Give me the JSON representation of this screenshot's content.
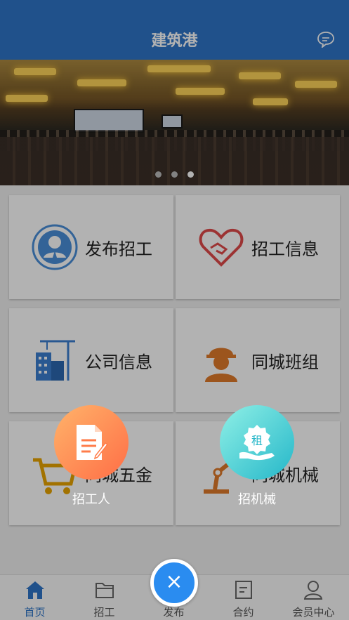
{
  "header": {
    "title": "建筑港",
    "chat_icon": "chat-bubble-icon"
  },
  "banner": {
    "slides": 3,
    "active_slide": 3
  },
  "grid": [
    {
      "label": "发布招工",
      "icon": "worker-avatar-icon",
      "color": "#4a8fd8"
    },
    {
      "label": "招工信息",
      "icon": "heart-handshake-icon",
      "color": "#e04a4a"
    },
    {
      "label": "公司信息",
      "icon": "building-crane-icon",
      "color": "#3b7fd0"
    },
    {
      "label": "同城班组",
      "icon": "helmet-worker-icon",
      "color": "#e07a2a"
    },
    {
      "label": "同城五金",
      "icon": "shopping-cart-icon",
      "color": "#e8a400"
    },
    {
      "label": "同城机械",
      "icon": "robot-arm-icon",
      "color": "#e07a2a"
    }
  ],
  "actions": [
    {
      "label": "招工人",
      "icon": "document-pen-icon"
    },
    {
      "label": "招机械",
      "icon": "rent-hand-icon",
      "badge": "租"
    }
  ],
  "close_button": {
    "symbol": "×"
  },
  "tabbar": [
    {
      "label": "首页",
      "icon": "home-icon",
      "active": true
    },
    {
      "label": "招工",
      "icon": "folder-icon",
      "active": false
    },
    {
      "label": "发布",
      "icon": "publish-icon",
      "active": false
    },
    {
      "label": "合约",
      "icon": "contract-icon",
      "active": false
    },
    {
      "label": "会员中心",
      "icon": "user-icon",
      "active": false
    }
  ],
  "colors": {
    "header": "#2e74c7",
    "accent": "#2a8cf0"
  }
}
